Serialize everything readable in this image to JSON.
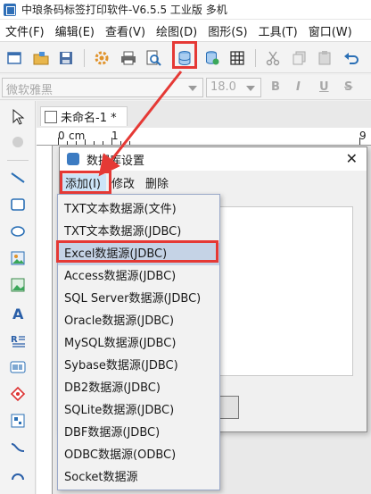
{
  "window": {
    "title": "中琅条码标签打印软件-V6.5.5 工业版 多机"
  },
  "menubar": {
    "items": [
      "文件(F)",
      "编辑(E)",
      "查看(V)",
      "绘图(D)",
      "图形(S)",
      "工具(T)",
      "窗口(W)"
    ]
  },
  "format_bar": {
    "font_name": "微软雅黑",
    "font_size": "18.0",
    "bold": "B",
    "italic": "I",
    "underline": "U",
    "strike": "S"
  },
  "document": {
    "tab_label": "未命名-1 *",
    "ruler_labels": [
      "0",
      "cm",
      "1",
      "9"
    ]
  },
  "dialog": {
    "title": "数据库设置",
    "close": "✕",
    "menu": [
      "添加(I)",
      "修改",
      "删除"
    ]
  },
  "dropdown": {
    "items": [
      "TXT文本数据源(文件)",
      "TXT文本数据源(JDBC)",
      "Excel数据源(JDBC)",
      "Access数据源(JDBC)",
      "SQL Server数据源(JDBC)",
      "Oracle数据源(JDBC)",
      "MySQL数据源(JDBC)",
      "Sybase数据源(JDBC)",
      "DB2数据源(JDBC)",
      "SQLite数据源(JDBC)",
      "DBF数据源(JDBC)",
      "ODBC数据源(ODBC)",
      "Socket数据源"
    ],
    "selected": "Excel数据源(JDBC)"
  },
  "colors": {
    "highlight": "#e53935",
    "selection": "#c5d3e6",
    "accent": "#2f6fb7"
  }
}
